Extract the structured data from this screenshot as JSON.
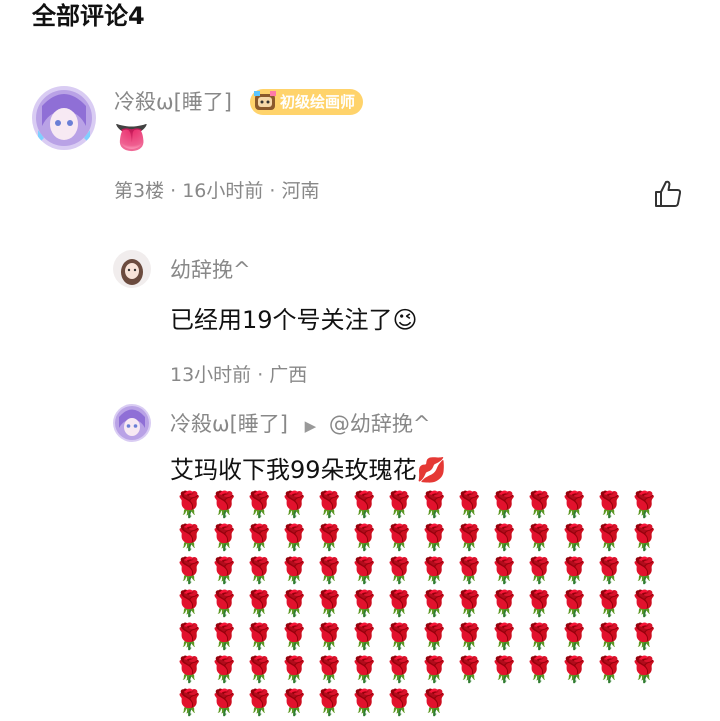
{
  "section": {
    "title": "全部评论4"
  },
  "comments": [
    {
      "username": "冷殺ω[睡了]",
      "badge": "初级绘画师",
      "text": "👅",
      "meta": "第3楼 · 16小时前 · 河南"
    }
  ],
  "replies": [
    {
      "username": "幼辞挽^",
      "text": "已经用19个号关注了😉",
      "meta": "13小时前 · 广西"
    },
    {
      "username": "冷殺ω[睡了]",
      "reply_to": "@幼辞挽^",
      "text": "艾玛收下我99朵玫瑰花💋",
      "roses": "🌹🌹🌹🌹🌹🌹🌹🌹🌹🌹🌹🌹🌹🌹🌹🌹🌹🌹🌹🌹🌹🌹🌹🌹🌹🌹🌹🌹🌹🌹🌹🌹🌹🌹🌹🌹🌹🌹🌹🌹🌹🌹🌹🌹🌹🌹🌹🌹🌹🌹🌹🌹🌹🌹🌹🌹🌹🌹🌹🌹🌹🌹🌹🌹🌹🌹🌹🌹🌹🌹🌹🌹🌹🌹🌹🌹🌹🌹🌹🌹🌹🌹🌹🌹🌹🌹🌹🌹🌹🌹🌹🌹"
    }
  ],
  "icons": {
    "like": "thumbs-up-icon",
    "reply_arrow": "triangle-right-icon",
    "badge": "painter-badge-icon"
  },
  "colors": {
    "badge": "#ffd36b",
    "meta": "#888888",
    "avatar_purple": "#b9a2e6"
  }
}
